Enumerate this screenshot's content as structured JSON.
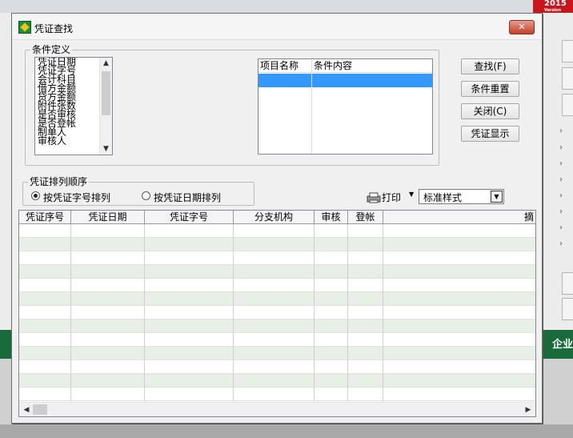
{
  "background": {
    "logo_text": "2015",
    "logo_sub": "Version",
    "right_banner_text": "企业"
  },
  "dialog": {
    "title": "凭证查找",
    "close_glyph": "✕"
  },
  "conditions": {
    "group_label": "条件定义",
    "fields": [
      "凭证日期",
      "凭证字号",
      "会计科目",
      "借方金额",
      "贷方金额",
      "附件张数",
      "是否审核",
      "是否登帐",
      "制单人",
      "审核人"
    ],
    "table_headers": [
      "项目名称",
      "条件内容"
    ]
  },
  "buttons": {
    "find": "查找(F)",
    "reset": "条件重置",
    "close": "关闭(C)",
    "show": "凭证显示"
  },
  "sort": {
    "group_label": "凭证排列顺序",
    "by_number": "按凭证字号排列",
    "by_date": "按凭证日期排列",
    "selected": "by_number"
  },
  "print": {
    "label": "打印",
    "style_value": "标准样式"
  },
  "grid": {
    "headers": [
      "凭证序号",
      "凭证日期",
      "凭证字号",
      "分支机构",
      "审核",
      "登帐",
      "摘"
    ]
  }
}
